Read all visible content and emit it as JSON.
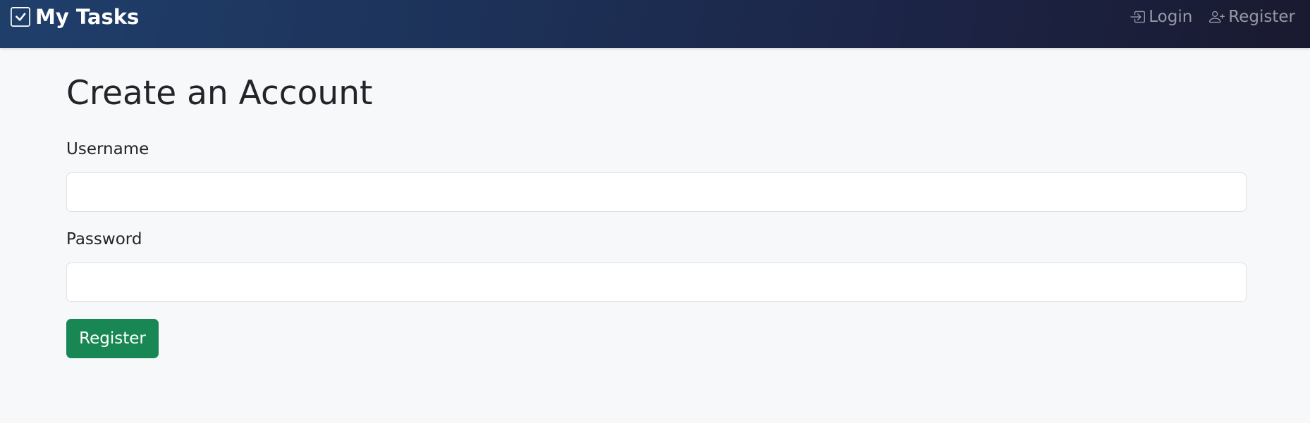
{
  "navbar": {
    "brand": "My Tasks",
    "brand_icon": "check-square-icon",
    "links": [
      {
        "label": "Login",
        "icon": "login-icon"
      },
      {
        "label": "Register",
        "icon": "person-plus-icon"
      }
    ]
  },
  "page": {
    "title": "Create an Account"
  },
  "form": {
    "username_label": "Username",
    "username_value": "",
    "password_label": "Password",
    "password_value": "",
    "submit_label": "Register"
  },
  "colors": {
    "navbar_start": "#1f3f6b",
    "navbar_end": "#1a1a30",
    "page_background": "#f7f8fa",
    "button_green": "#198754",
    "nav_link_muted": "rgba(255,255,255,0.55)"
  }
}
